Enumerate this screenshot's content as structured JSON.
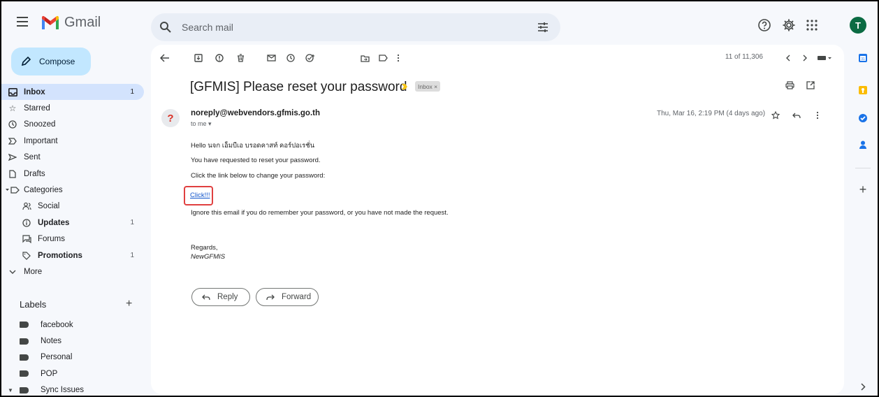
{
  "app": {
    "name": "Gmail"
  },
  "header": {
    "search": {
      "placeholder": "Search mail",
      "value": ""
    },
    "avatar_initial": "T"
  },
  "compose": {
    "label": "Compose"
  },
  "nav": [
    {
      "label": "Inbox",
      "count": "1",
      "icon": "inbox-icon"
    },
    {
      "label": "Starred",
      "count": "",
      "icon": "star-icon"
    },
    {
      "label": "Snoozed",
      "count": "",
      "icon": "clock-icon"
    },
    {
      "label": "Important",
      "count": "",
      "icon": "important-icon"
    },
    {
      "label": "Sent",
      "count": "",
      "icon": "send-icon"
    },
    {
      "label": "Drafts",
      "count": "",
      "icon": "draft-icon"
    },
    {
      "label": "Categories",
      "count": "",
      "icon": "label-icon"
    },
    {
      "label": "Social",
      "count": "",
      "icon": "people-icon"
    },
    {
      "label": "Updates",
      "count": "1",
      "icon": "info-icon"
    },
    {
      "label": "Forums",
      "count": "",
      "icon": "forum-icon"
    },
    {
      "label": "Promotions",
      "count": "1",
      "icon": "tag-icon"
    },
    {
      "label": "More",
      "count": "",
      "icon": "chevron-down-icon"
    }
  ],
  "labels": {
    "title": "Labels",
    "add": "+",
    "items": [
      "facebook",
      "Notes",
      "Personal",
      "POP",
      "Sync Issues"
    ]
  },
  "toolbar": {
    "pager": "11 of 11,306"
  },
  "message": {
    "subject": "[GFMIS] Please reset your password",
    "label_chip": "Inbox ×",
    "sender_initial": "?",
    "sender": "noreply@webvendors.gfmis.go.th",
    "to": "to me ▾",
    "date": "Thu, Mar 16, 2:19 PM (4 days ago)",
    "lines": [
      "Hello นจก เอ็มบีเอ บรอดคาสท์ คอร์ปอเรชั่น",
      "You have requested to reset your password.",
      "Click the link below to change your password:"
    ],
    "link": "Click!!!",
    "ignore": "Ignore this email if you do remember your password, or you have not made the request.",
    "regards": "Regards,",
    "signature": "NewGFMIS"
  },
  "actions": {
    "reply": "Reply",
    "forward": "Forward"
  },
  "colors": {
    "accent": "#c2e7ff",
    "active_nav": "#d3e3fd",
    "link": "#1155cc",
    "highlight_box": "#e04040",
    "avatar": "#0b6b43"
  }
}
